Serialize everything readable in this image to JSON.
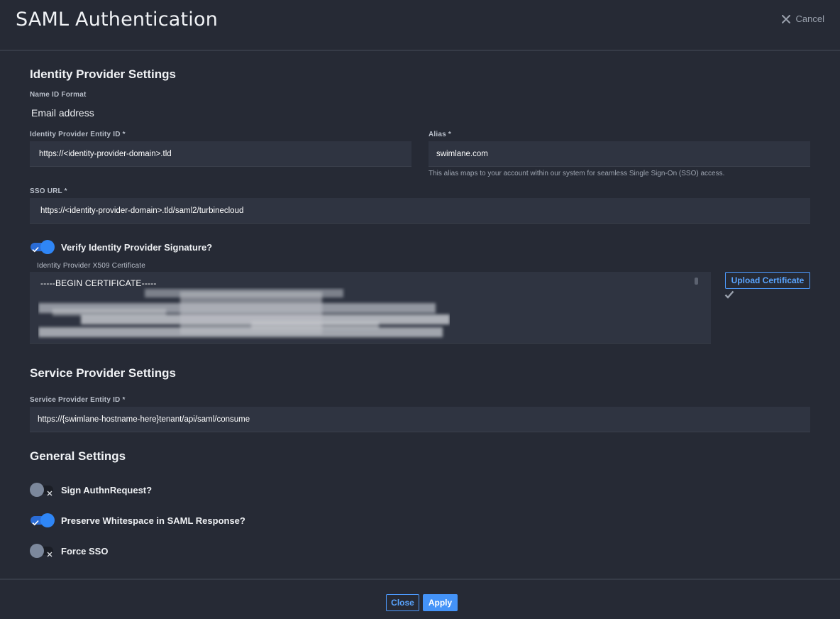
{
  "header": {
    "title": "SAML Authentication",
    "cancel_label": "Cancel"
  },
  "identity_provider": {
    "section_title": "Identity Provider Settings",
    "name_id_format_label": "Name ID Format",
    "name_id_format_value": "Email address",
    "entity_id_label": "Identity Provider Entity ID  *",
    "entity_id_value": "https://<identity-provider-domain>.tld",
    "alias_label": "Alias  *",
    "alias_value": "swimlane.com",
    "alias_helper": "This alias maps to your account within our system for seamless Single Sign-On (SSO) access.",
    "sso_url_label": "SSO URL  *",
    "sso_url_value": "https://<identity-provider-domain>.tld/saml2/turbinecloud",
    "verify_signature_label": "Verify Identity Provider Signature?",
    "verify_signature_on": true,
    "certificate_label": "Identity Provider X509 Certificate",
    "certificate_first_line": "-----BEGIN CERTIFICATE-----",
    "upload_certificate_label": "Upload Certificate"
  },
  "service_provider": {
    "section_title": "Service Provider Settings",
    "entity_id_label": "Service Provider Entity ID  *",
    "entity_id_value": "https://{swimlane-hostname-here}tenant/api/saml/consume"
  },
  "general": {
    "section_title": "General Settings",
    "toggles": [
      {
        "label": "Sign AuthnRequest?",
        "on": false
      },
      {
        "label": "Preserve Whitespace in SAML Response?",
        "on": true
      },
      {
        "label": "Force SSO",
        "on": false
      }
    ]
  },
  "footer": {
    "close_label": "Close",
    "apply_label": "Apply"
  },
  "colors": {
    "background": "#262a35",
    "field_background": "#2f3441",
    "accent": "#4493f8",
    "toggle_on": "#2f86f6",
    "toggle_off": "#7c889c"
  }
}
